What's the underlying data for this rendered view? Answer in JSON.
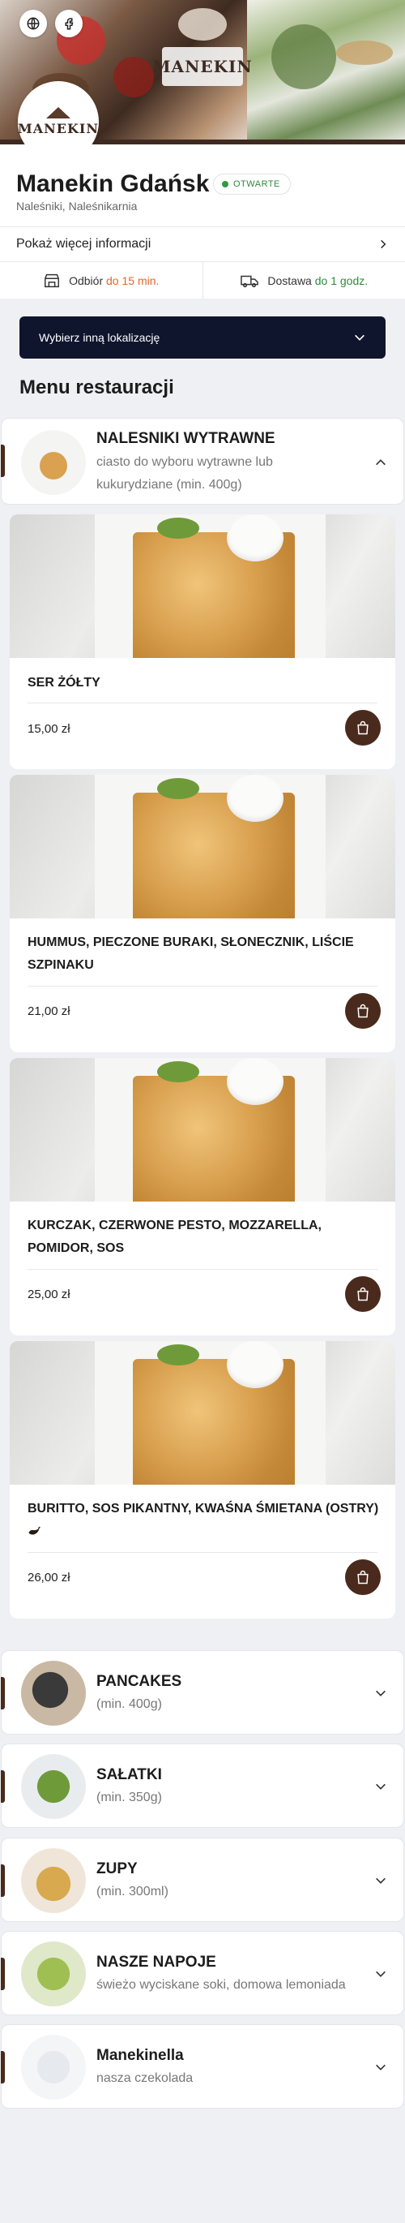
{
  "hero": {
    "sign_text": "MANEKIN",
    "logo_text": "MANEKIN"
  },
  "restaurant": {
    "name": "Manekin Gdańsk",
    "status": "OTWARTE",
    "categories": "Naleśniki, Naleśnikarnia",
    "more_info_label": "Pokaż więcej informacji"
  },
  "delivery": {
    "pickup_label": "Odbiór",
    "pickup_time": "do 15 min.",
    "delivery_label": "Dostawa",
    "delivery_time": "do 1 godz."
  },
  "location_button": "Wybierz inną lokalizację",
  "menu_heading": "Menu restauracji",
  "open_category": {
    "name": "NALESNIKI WYTRAWNE",
    "description": "ciasto do wyboru wytrawne lub kukurydziane (min. 400g)"
  },
  "products": [
    {
      "name": "SER ŻÓŁTY",
      "price": "15,00 zł"
    },
    {
      "name": "HUMMUS, PIECZONE BURAKI, SŁONECZNIK, LIŚCIE SZPINAKU",
      "price": "21,00 zł"
    },
    {
      "name": "KURCZAK, CZERWONE PESTO, MOZZARELLA, POMIDOR, SOS",
      "price": "25,00 zł"
    },
    {
      "name": "BURITTO, SOS PIKANTNY, KWAŚNA ŚMIETANA (OSTRY)",
      "price": "26,00 zł"
    }
  ],
  "categories": [
    {
      "name": "PANCAKES",
      "description": "(min. 400g)",
      "thumb_colors": [
        "#3a3a3a",
        "#c9b9a4"
      ]
    },
    {
      "name": "SAŁATKI",
      "description": "(min. 350g)",
      "thumb_colors": [
        "#e9ecef",
        "#6f9a3a"
      ]
    },
    {
      "name": "ZUPY",
      "description": "(min. 300ml)",
      "thumb_colors": [
        "#efe6d9",
        "#d8a94e"
      ]
    },
    {
      "name": "NASZE NAPOJE",
      "description": "świeżo wyciskane soki, domowa lemoniada",
      "thumb_colors": [
        "#dfe8c9",
        "#9fbf52"
      ]
    },
    {
      "name": "Manekinella",
      "description": "nasza czekolada",
      "thumb_colors": [
        "#f4f5f7",
        "#e6e9ee"
      ]
    }
  ],
  "colors": {
    "brand_brown": "#4a2a1c",
    "location_button_bg": "#10152e",
    "open_status": "#2f8a3c",
    "pickup_accent": "#e0672b",
    "page_bg": "#eef0f4"
  }
}
